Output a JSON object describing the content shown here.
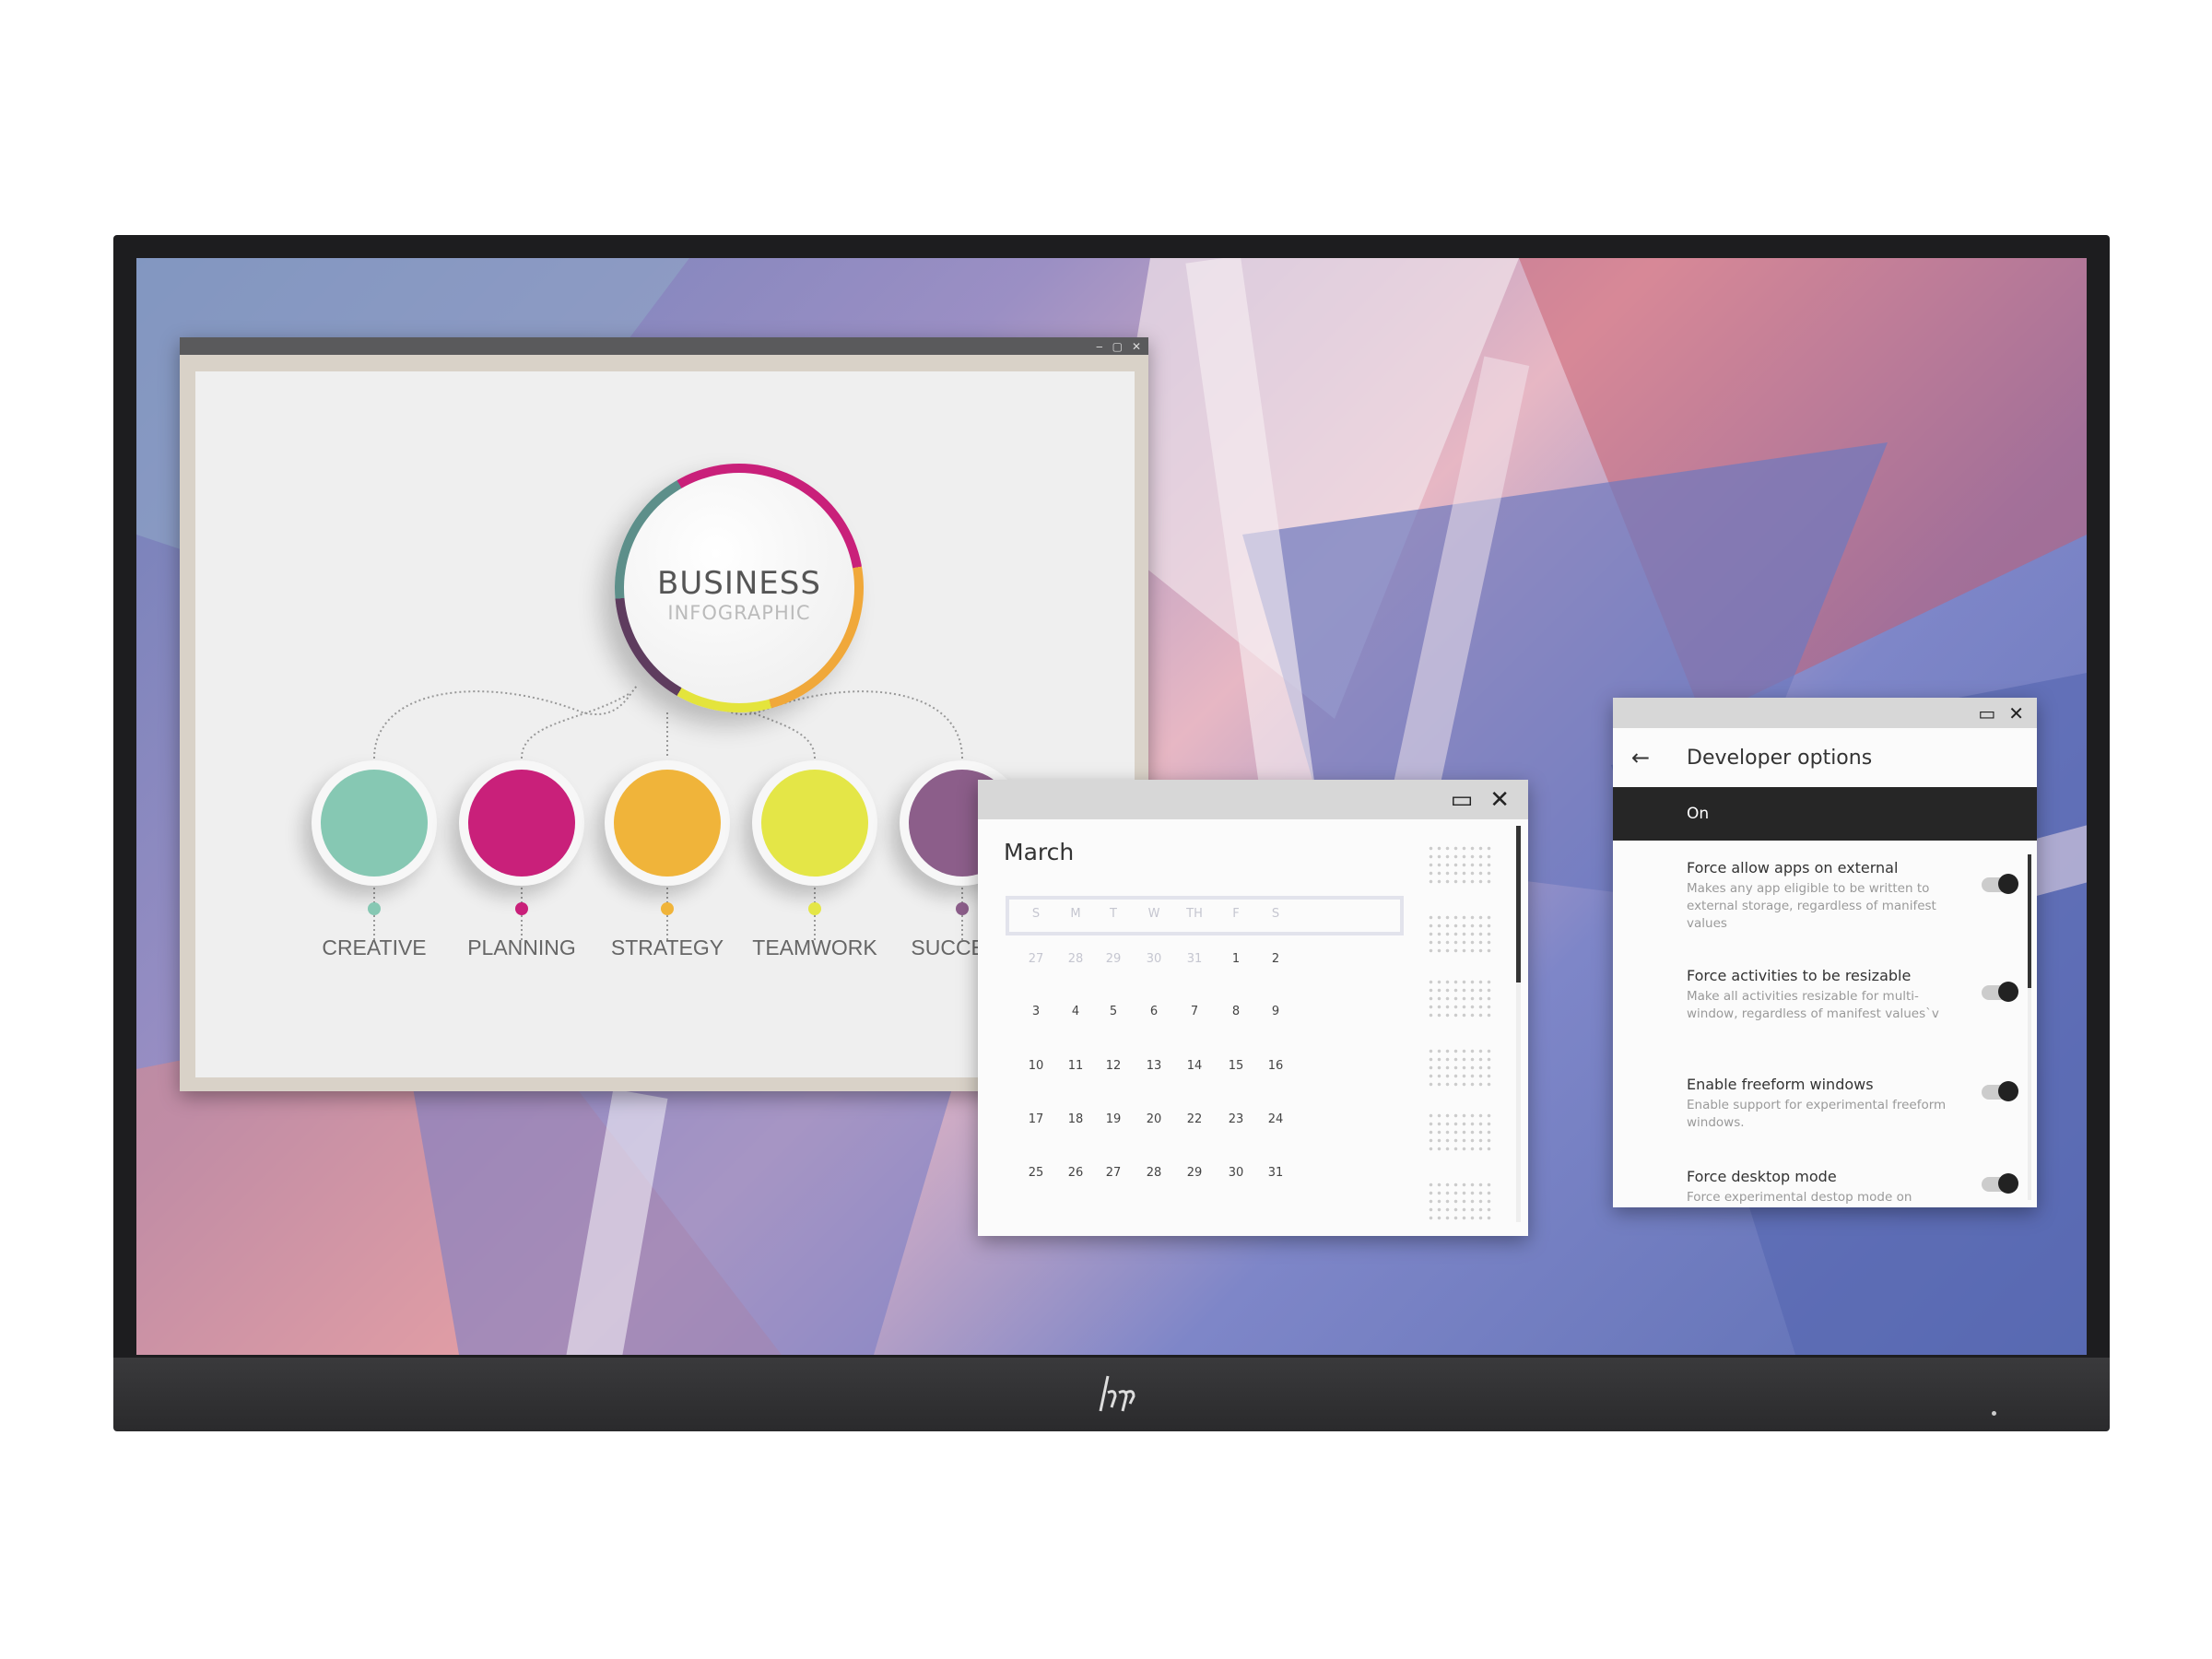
{
  "presentation": {
    "controls": [
      "‒",
      "▢",
      "✕"
    ],
    "title": "BUSINESS",
    "subtitle": "INFOGRAPHIC",
    "nodes": [
      {
        "label": "CREATIVE",
        "color": "#86c8b3"
      },
      {
        "label": "PLANNING",
        "color": "#c9207a"
      },
      {
        "label": "STRATEGY",
        "color": "#f0b43a"
      },
      {
        "label": "TEAMWORK",
        "color": "#e4e647"
      },
      {
        "label": "SUCCESS",
        "color": "#8c5e8a"
      }
    ]
  },
  "calendar": {
    "month": "March",
    "weekdays": [
      "S",
      "M",
      "T",
      "W",
      "TH",
      "F",
      "S"
    ],
    "weeks": [
      [
        "27",
        "28",
        "29",
        "30",
        "31",
        "1",
        "2"
      ],
      [
        "3",
        "4",
        "5",
        "6",
        "7",
        "8",
        "9"
      ],
      [
        "10",
        "11",
        "12",
        "13",
        "14",
        "15",
        "16"
      ],
      [
        "17",
        "18",
        "19",
        "20",
        "22",
        "23",
        "24"
      ],
      [
        "25",
        "26",
        "27",
        "28",
        "29",
        "30",
        "31"
      ]
    ],
    "controls": {
      "snap_icon": "window-snap-icon",
      "close_icon": "close-icon"
    }
  },
  "developer_options": {
    "title": "Developer options",
    "master": "On",
    "items": [
      {
        "title": "Force allow apps on external",
        "desc": "Makes any app eligible to be written to external storage, regardless of manifest values",
        "on": true
      },
      {
        "title": "Force activities to be resizable",
        "desc": "Make all activities resizable for multi-window, regardless of manifest values`v",
        "on": true
      },
      {
        "title": "Enable freeform windows",
        "desc": "Enable support for experimental freeform windows.",
        "on": true
      },
      {
        "title": "Force desktop mode",
        "desc": "Force experimental destop mode on",
        "on": true
      }
    ]
  },
  "monitor": {
    "logo": "hp"
  }
}
